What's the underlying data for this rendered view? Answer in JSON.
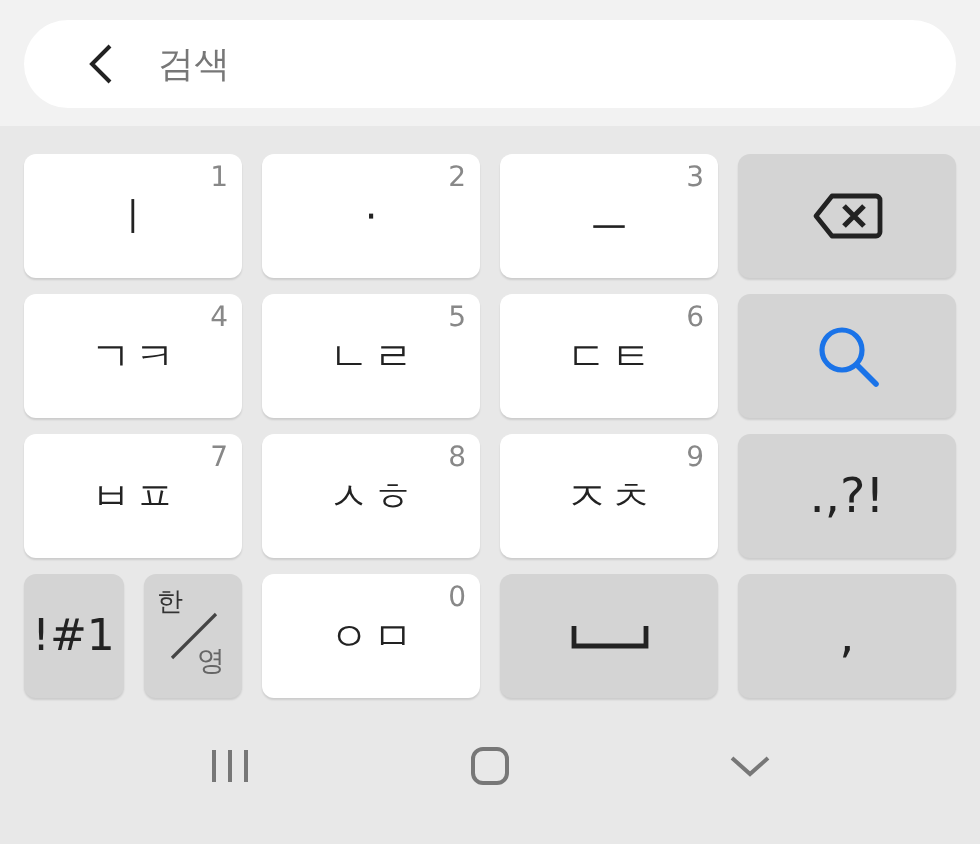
{
  "search": {
    "placeholder": "검색"
  },
  "keys": [
    {
      "kind": "letter",
      "label": "ㅣ",
      "number": "1"
    },
    {
      "kind": "letter",
      "label": "·",
      "number": "2"
    },
    {
      "kind": "letter",
      "label": "ㅡ",
      "number": "3"
    },
    {
      "kind": "backspace"
    },
    {
      "kind": "letter",
      "label": "ㄱㅋ",
      "number": "4"
    },
    {
      "kind": "letter",
      "label": "ㄴㄹ",
      "number": "5"
    },
    {
      "kind": "letter",
      "label": "ㄷㅌ",
      "number": "6"
    },
    {
      "kind": "search"
    },
    {
      "kind": "letter",
      "label": "ㅂㅍ",
      "number": "7"
    },
    {
      "kind": "letter",
      "label": "ㅅㅎ",
      "number": "8"
    },
    {
      "kind": "letter",
      "label": "ㅈㅊ",
      "number": "9"
    },
    {
      "kind": "symbol",
      "label": ".,?!"
    },
    {
      "kind": "mode",
      "label": "!#1"
    },
    {
      "kind": "lang",
      "top": "한",
      "bottom": "영"
    },
    {
      "kind": "letter",
      "label": "ㅇㅁ",
      "number": "0"
    },
    {
      "kind": "space"
    },
    {
      "kind": "symbol",
      "label": ","
    }
  ],
  "nav": [
    {
      "kind": "recent"
    },
    {
      "kind": "home"
    },
    {
      "kind": "back"
    }
  ]
}
